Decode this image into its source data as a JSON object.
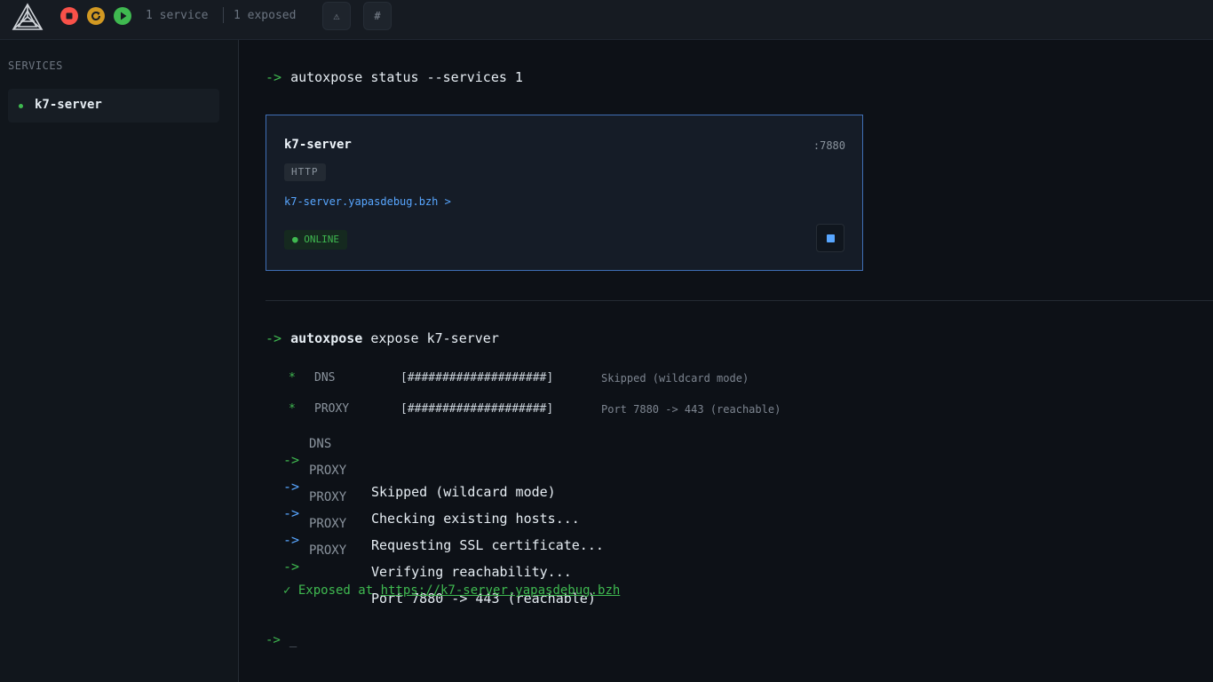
{
  "topbar": {
    "stat_services": "1 service",
    "stat_exposed": "1 exposed",
    "icon_warning": "⚠",
    "icon_hash": "#",
    "colors": {
      "stop": "#f85149",
      "restart": "#d29922",
      "start": "#3fb950"
    }
  },
  "sidebar": {
    "title": "SERVICES",
    "items": [
      {
        "label": "k7-server",
        "status": "online"
      }
    ]
  },
  "terminal": {
    "arrow": "->",
    "cmd_status": "autoxpose status --services 1",
    "card": {
      "name": "k7-server",
      "port": ":7880",
      "protocol": "HTTP",
      "link": "k7-server.yapasdebug.bzh >",
      "status": "● ONLINE"
    },
    "cmd_expose_bin": "autoxpose",
    "cmd_expose_args": "expose k7-server",
    "progress": [
      {
        "star": "*",
        "label": "DNS",
        "bar": "[####################]",
        "note": "Skipped (wildcard mode)"
      },
      {
        "star": "*",
        "label": "PROXY",
        "bar": "[####################]",
        "note": "Port 7880 -> 443 (reachable)"
      }
    ],
    "logs": [
      {
        "arrow": "->",
        "tag": "DNS",
        "msg": "Skipped (wildcard mode)",
        "color": "green"
      },
      {
        "arrow": "->",
        "tag": "PROXY",
        "msg": "Checking existing hosts...",
        "color": "blue"
      },
      {
        "arrow": "->",
        "tag": "PROXY",
        "msg": "Requesting SSL certificate...",
        "color": "blue"
      },
      {
        "arrow": "->",
        "tag": "PROXY",
        "msg": "Verifying reachability...",
        "color": "blue"
      },
      {
        "arrow": "->",
        "tag": "PROXY",
        "msg": "Port 7880 -> 443 (reachable)",
        "color": "green"
      }
    ],
    "exposed_prefix": "✓ Exposed at ",
    "exposed_url": "https://k7-server.yapasdebug.bzh",
    "prompt_arrow": "->",
    "prompt_cursor": "_"
  }
}
